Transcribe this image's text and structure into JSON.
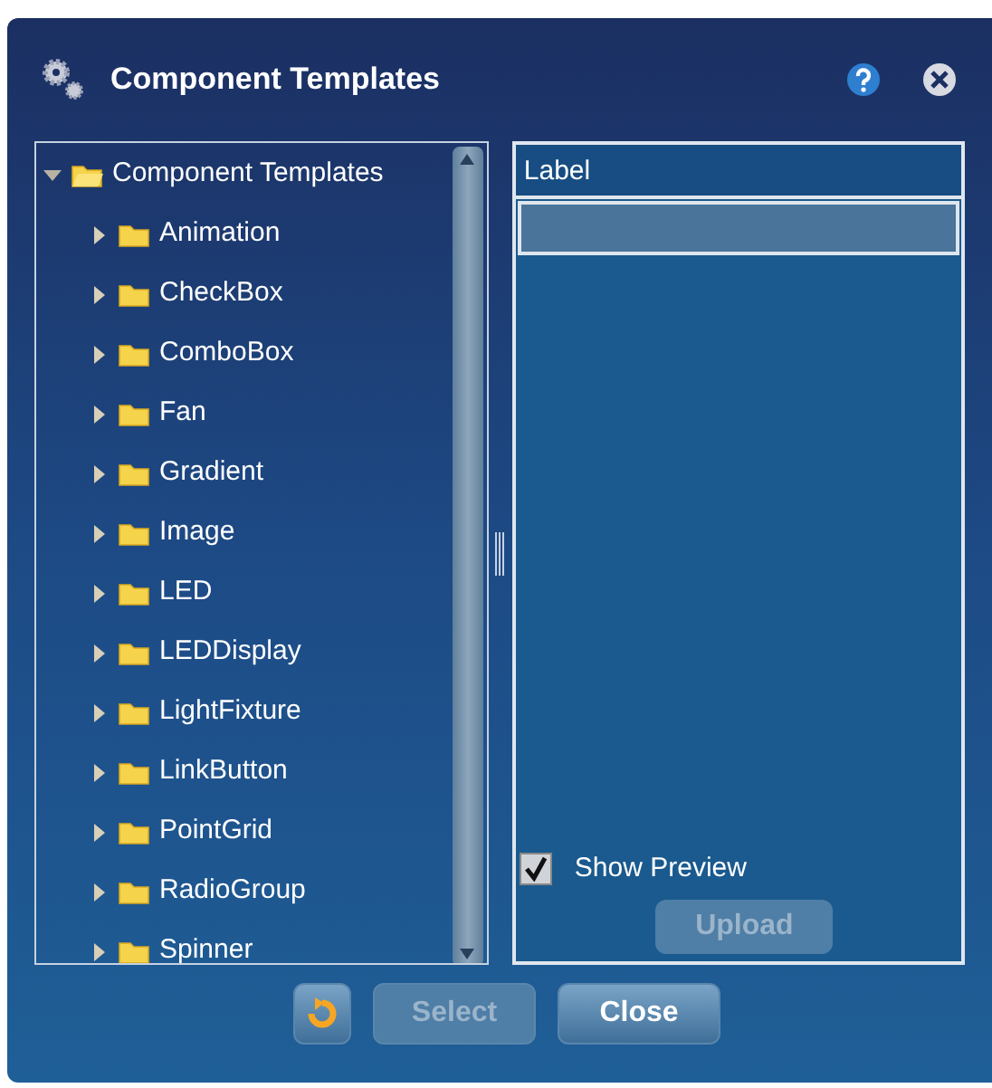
{
  "window": {
    "title": "Component Templates"
  },
  "tree": {
    "label": "Component Templates",
    "expanded": true,
    "children": [
      {
        "label": "Animation",
        "expanded": false
      },
      {
        "label": "CheckBox",
        "expanded": false
      },
      {
        "label": "ComboBox",
        "expanded": false
      },
      {
        "label": "Fan",
        "expanded": false
      },
      {
        "label": "Gradient",
        "expanded": false
      },
      {
        "label": "Image",
        "expanded": false
      },
      {
        "label": "LED",
        "expanded": false
      },
      {
        "label": "LEDDisplay",
        "expanded": false
      },
      {
        "label": "LightFixture",
        "expanded": false
      },
      {
        "label": "LinkButton",
        "expanded": false
      },
      {
        "label": "PointGrid",
        "expanded": false
      },
      {
        "label": "RadioGroup",
        "expanded": false
      },
      {
        "label": "Spinner",
        "expanded": false
      }
    ]
  },
  "properties": {
    "label": "Label"
  },
  "show_preview": {
    "label": "Show Preview",
    "checked": true
  },
  "upload": {
    "label": "Upload",
    "disabled": true
  },
  "buttons": [
    {
      "kind": "icon",
      "disabled": false
    },
    {
      "kind": "text",
      "label": "Select",
      "disabled": true
    },
    {
      "kind": "text",
      "label": "Close",
      "disabled": false
    }
  ]
}
